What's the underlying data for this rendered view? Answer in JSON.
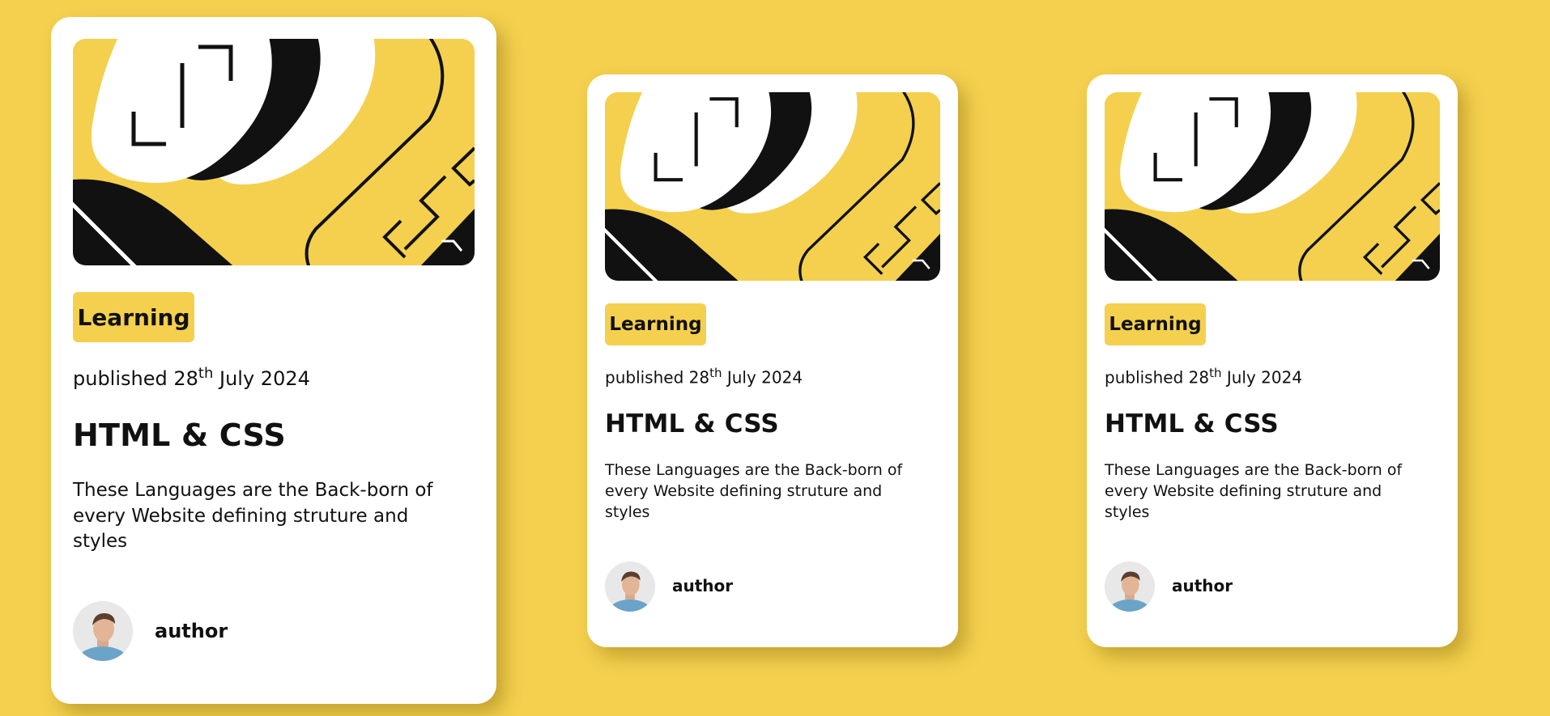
{
  "colors": {
    "background": "#F4D04E",
    "card": "#FFFFFF",
    "tag": "#F4D04E",
    "text": "#111111"
  },
  "cards": [
    {
      "tag": "Learning",
      "published_prefix": "published 28",
      "published_suffix": "th",
      "published_rest": " July 2024",
      "title": "HTML & CSS",
      "description": "These Languages are the Back-born of every Website defining struture and styles",
      "author": "author"
    },
    {
      "tag": "Learning",
      "published_prefix": "published 28",
      "published_suffix": "th",
      "published_rest": " July 2024",
      "title": "HTML & CSS",
      "description": "These Languages are the Back-born of every Website defining struture and styles",
      "author": "author"
    },
    {
      "tag": "Learning",
      "published_prefix": "published 28",
      "published_suffix": "th",
      "published_rest": " July 2024",
      "title": "HTML & CSS",
      "description": "These Languages are the Back-born of every Website defining struture and styles",
      "author": "author"
    }
  ]
}
